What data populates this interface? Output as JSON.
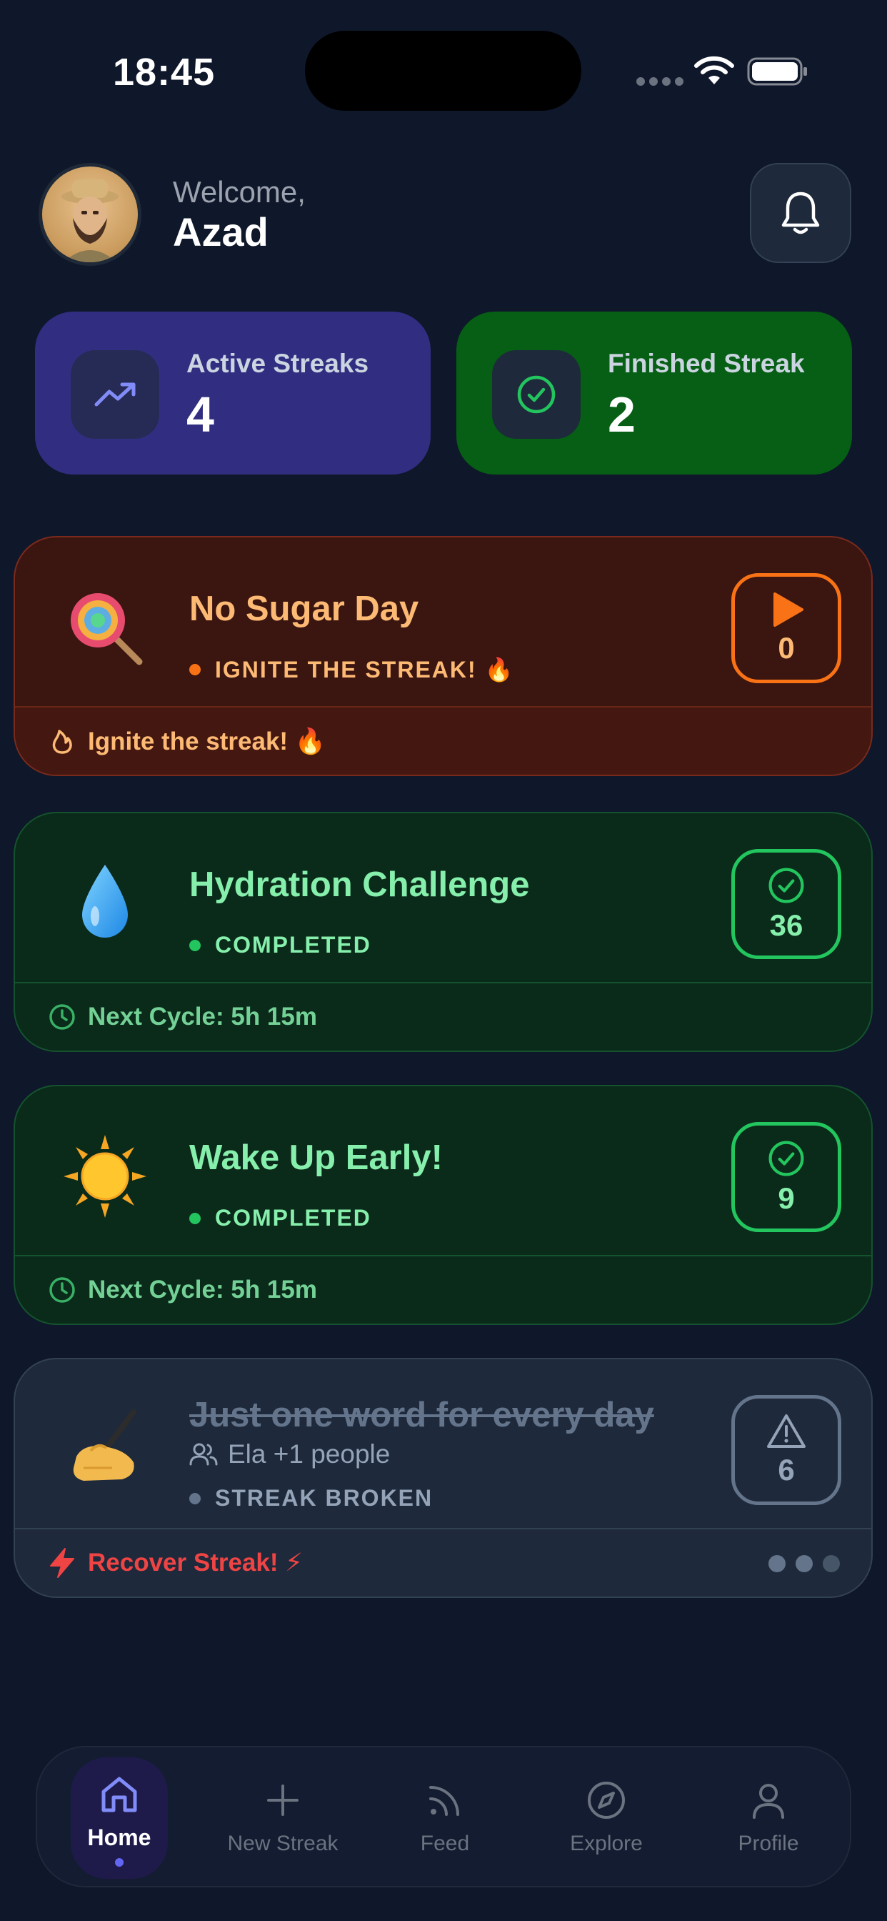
{
  "status_bar": {
    "time": "18:45"
  },
  "header": {
    "welcome": "Welcome,",
    "username": "Azad"
  },
  "stats": {
    "active": {
      "label": "Active Streaks",
      "value": "4",
      "icon": "trending-up-icon"
    },
    "finished": {
      "label": "Finished Streak",
      "value": "2",
      "icon": "check-circle-icon"
    }
  },
  "streaks": [
    {
      "emoji": "🍭",
      "title": "No Sugar Day",
      "status": "IGNITE THE STREAK! 🔥",
      "badge": "0",
      "badge_icon": "play-icon",
      "footer": "Ignite the streak! 🔥",
      "footer_icon": "flame-icon"
    },
    {
      "emoji": "💧",
      "title": "Hydration Challenge",
      "status": "COMPLETED",
      "badge": "36",
      "badge_icon": "check-circle-icon",
      "footer": "Next Cycle: 5h 15m",
      "footer_icon": "clock-icon"
    },
    {
      "emoji": "☀️",
      "title": "Wake Up Early!",
      "status": "COMPLETED",
      "badge": "9",
      "badge_icon": "check-circle-icon",
      "footer": "Next Cycle: 5h 15m",
      "footer_icon": "clock-icon"
    },
    {
      "emoji": "✍️",
      "title": "Just one word for every day",
      "people": "Ela +1 people",
      "status": "STREAK BROKEN",
      "badge": "6",
      "badge_icon": "warning-icon",
      "footer": "Recover Streak! ⚡",
      "footer_icon": "bolt-icon"
    }
  ],
  "tabs": [
    {
      "label": "Home",
      "icon": "home-icon",
      "active": true
    },
    {
      "label": "New Streak",
      "icon": "plus-icon"
    },
    {
      "label": "Feed",
      "icon": "rss-icon"
    },
    {
      "label": "Explore",
      "icon": "compass-icon"
    },
    {
      "label": "Profile",
      "icon": "user-icon"
    }
  ],
  "colors": {
    "background": "#0f172a",
    "accent": "#6366f1",
    "success": "#22c55e",
    "warning": "#f97316",
    "danger": "#ef4444"
  }
}
